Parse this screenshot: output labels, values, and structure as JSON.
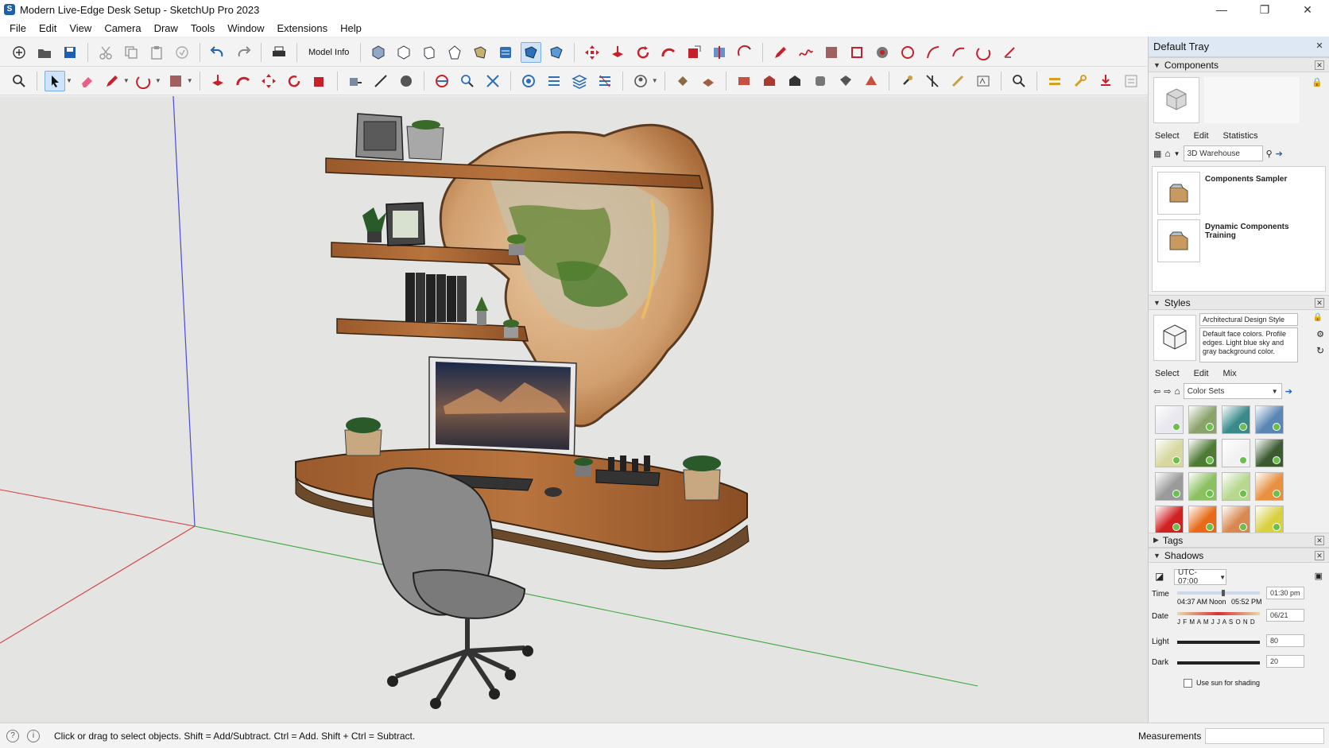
{
  "window": {
    "title": "Modern Live-Edge Desk Setup - SketchUp Pro 2023",
    "app_icon": "S",
    "minimize": "—",
    "restore": "❐",
    "close": "✕"
  },
  "menu": {
    "items": [
      "File",
      "Edit",
      "View",
      "Camera",
      "Draw",
      "Tools",
      "Window",
      "Extensions",
      "Help"
    ]
  },
  "toolbar": {
    "model_info_label": "Model Info"
  },
  "status": {
    "hint": "Click or drag to select objects. Shift = Add/Subtract. Ctrl = Add. Shift + Ctrl = Subtract.",
    "measurements_label": "Measurements"
  },
  "tray": {
    "title": "Default Tray",
    "components": {
      "header": "Components",
      "tabs": [
        "Select",
        "Edit",
        "Statistics"
      ],
      "search_value": "3D Warehouse",
      "items": [
        {
          "name": "Components Sampler"
        },
        {
          "name": "Dynamic Components Training"
        }
      ]
    },
    "styles": {
      "header": "Styles",
      "style_name": "Architectural Design Style",
      "style_description": "Default face colors. Profile edges. Light blue sky and gray background color.",
      "tabs": [
        "Select",
        "Edit",
        "Mix"
      ],
      "collection": "Color Sets",
      "swatch_colors": [
        [
          "#e8e8ee",
          "#8aa36a",
          "#3a8a8c",
          "#5a86b4"
        ],
        [
          "#d6d8a0",
          "#4e7a34",
          "#f2f2f2",
          "#3a5a30"
        ],
        [
          "#9a9a9a",
          "#8ac060",
          "#b8d890",
          "#e89040"
        ],
        [
          "#d02020",
          "#e86a18",
          "#d88850",
          "#d8d040"
        ]
      ]
    },
    "tags": {
      "header": "Tags"
    },
    "shadows": {
      "header": "Shadows",
      "timezone": "UTC-07:00",
      "time_label": "Time",
      "time_start": "04:37 AM",
      "time_noon": "Noon",
      "time_end": "05:52 PM",
      "time_value": "01:30 pm",
      "date_label": "Date",
      "months": "J F M A M J J A S O N D",
      "date_value": "06/21",
      "light_label": "Light",
      "light_value": "80",
      "dark_label": "Dark",
      "dark_value": "20",
      "use_sun_label": "Use sun for shading"
    }
  }
}
